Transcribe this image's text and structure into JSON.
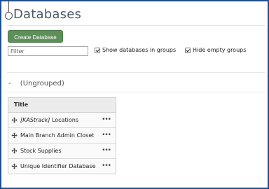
{
  "header": {
    "title": "Databases"
  },
  "toolbar": {
    "create_label": "Create Database",
    "filter_placeholder": "Filter",
    "filter_value": "",
    "show_groups_label": "Show databases in groups",
    "show_groups_checked": true,
    "hide_empty_label": "Hide empty groups",
    "hide_empty_checked": true
  },
  "group": {
    "toggle": "-",
    "name": "(Ungrouped)",
    "column_title": "Title",
    "rows": [
      {
        "prefix": "[KAStrack]",
        "label": " Locations"
      },
      {
        "prefix": "",
        "label": "Main Branch Admin Closet"
      },
      {
        "prefix": "",
        "label": "Stock Supplies"
      },
      {
        "prefix": "",
        "label": "Unique Identifier Database"
      }
    ],
    "more_glyph": "•••"
  },
  "colors": {
    "frame": "#1f4e8c",
    "button": "#5e8f5b",
    "table_header": "#ececec"
  },
  "icons": {
    "row_drag": "move-arrows-icon",
    "row_menu": "more-dots-icon",
    "checkbox": "checkmark-icon"
  }
}
